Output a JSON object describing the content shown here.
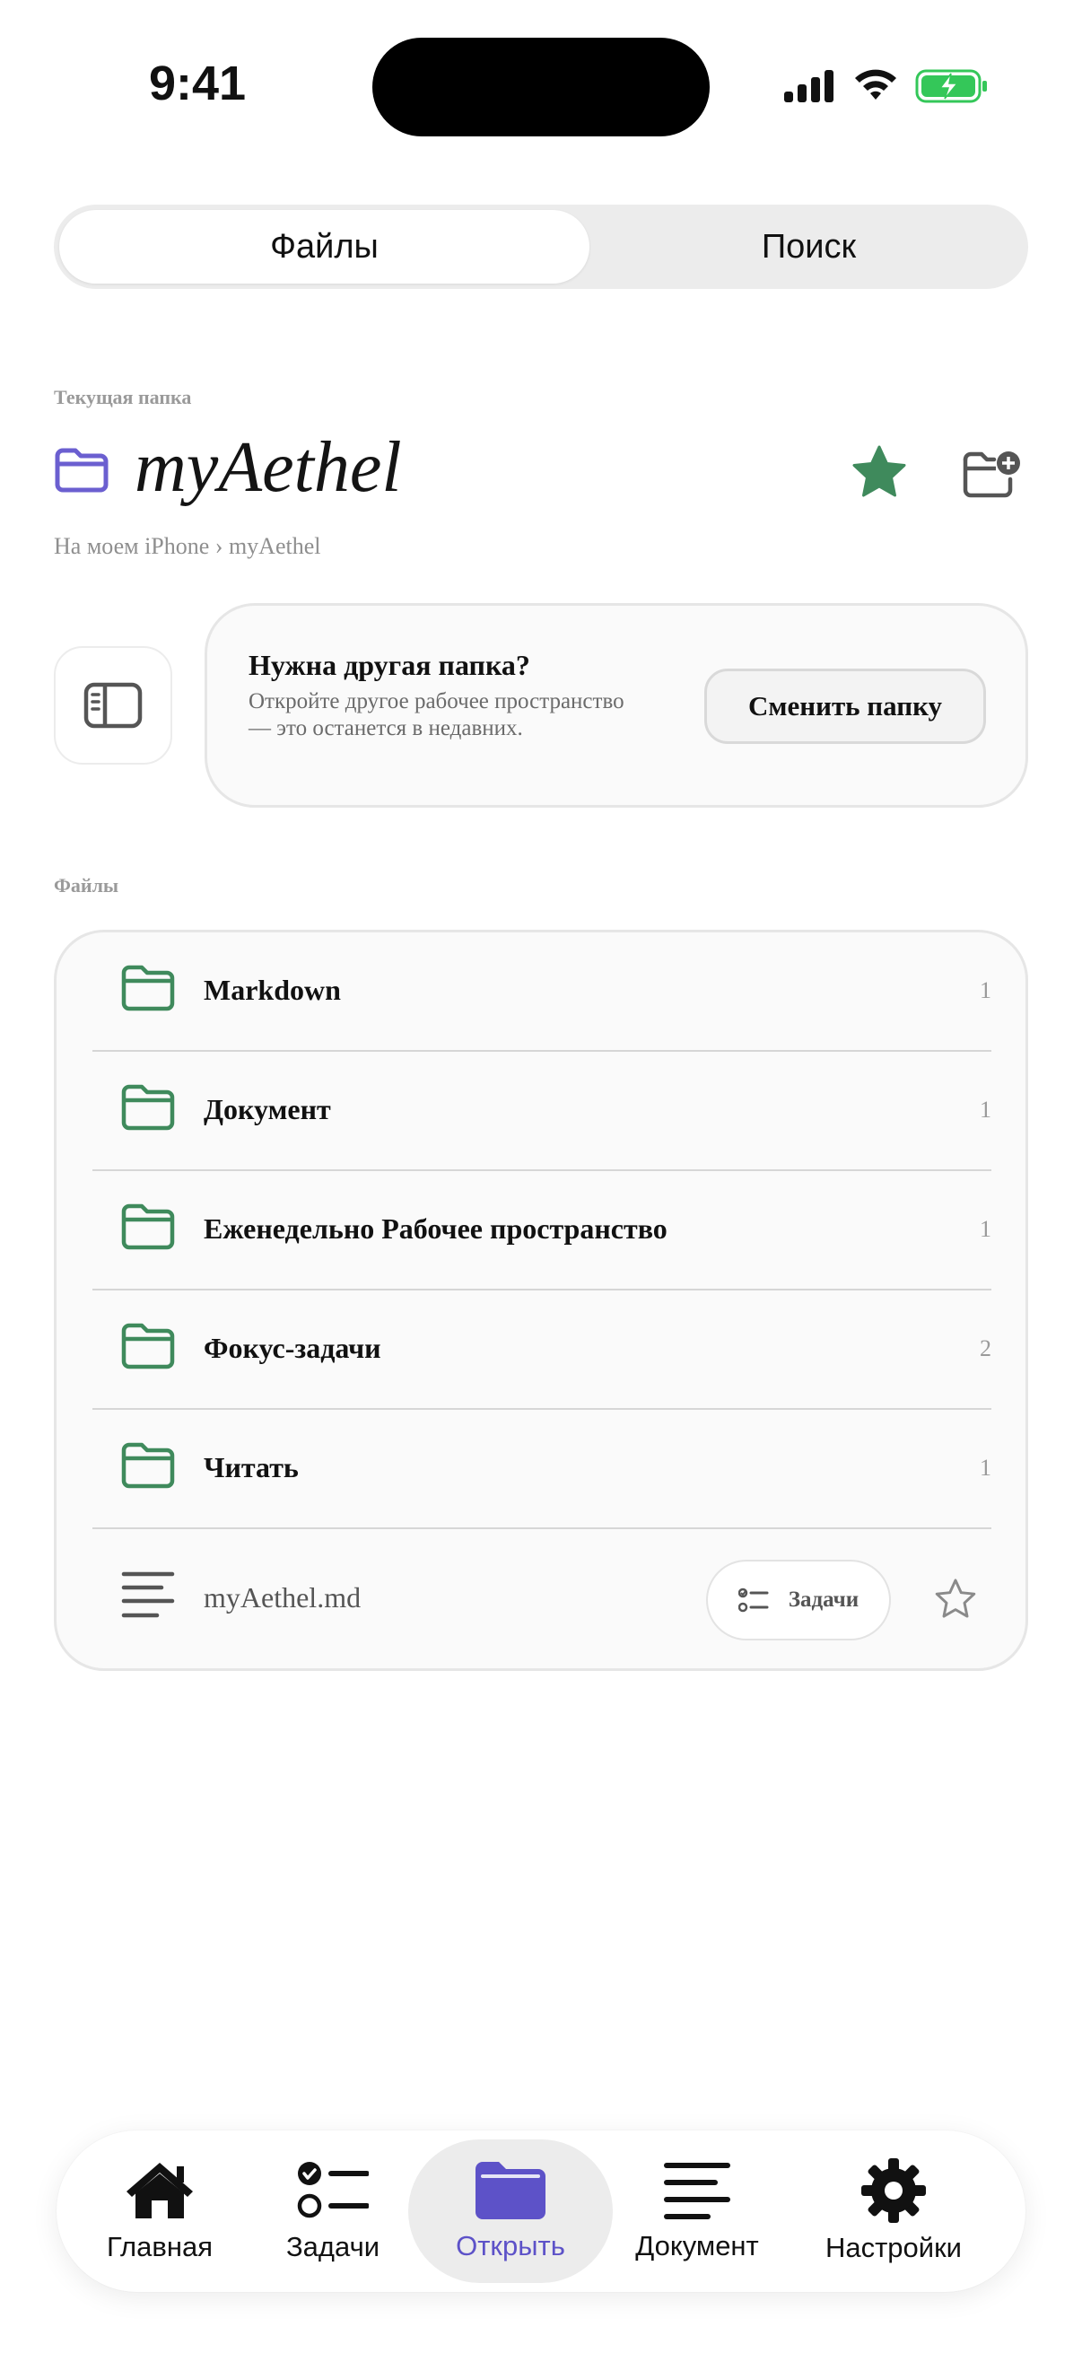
{
  "status_bar": {
    "time": "9:41"
  },
  "segmented": {
    "files_label": "Файлы",
    "search_label": "Поиск"
  },
  "current_folder": {
    "section_label": "Текущая папка",
    "name": "myAethel",
    "breadcrumb": "На моем iPhone › myAethel"
  },
  "change_folder_card": {
    "title": "Нужна другая папка?",
    "description": "Откройте другое рабочее пространство — это останется в недавних.",
    "button_label": "Сменить папку"
  },
  "files": {
    "section_label": "Файлы",
    "folders": [
      {
        "name": "Markdown",
        "count": "1"
      },
      {
        "name": "Документ",
        "count": "1"
      },
      {
        "name": "Еженедельно Рабочее пространство",
        "count": "1"
      },
      {
        "name": "Фокус-задачи",
        "count": "2"
      },
      {
        "name": "Читать",
        "count": "1"
      }
    ],
    "file": {
      "name": "myAethel.md",
      "tasks_label": "Задачи"
    }
  },
  "tab_bar": {
    "items": [
      {
        "label": "Главная",
        "icon": "house-icon"
      },
      {
        "label": "Задачи",
        "icon": "checklist-icon"
      },
      {
        "label": "Открыть",
        "icon": "folder-icon"
      },
      {
        "label": "Документ",
        "icon": "text-lines-icon"
      },
      {
        "label": "Настройки",
        "icon": "gear-icon"
      }
    ],
    "active_index": 2
  },
  "colors": {
    "accent_purple": "#5d52c8",
    "folder_green": "#3f8a5c",
    "star_green": "#3f8a5c",
    "battery_green": "#34c759"
  }
}
